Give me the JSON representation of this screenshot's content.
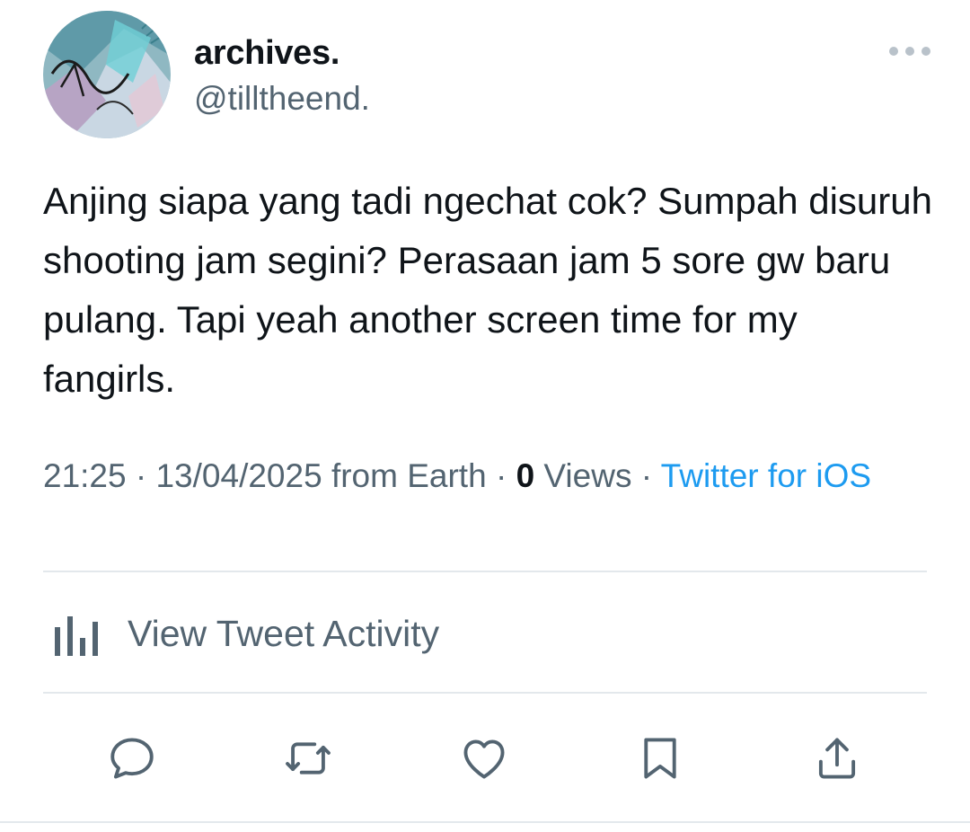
{
  "profile": {
    "name": "archives.",
    "handle": "@tilltheend."
  },
  "tweet": {
    "text": "Anjing siapa yang tadi ngechat cok? Sumpah disuruh shooting jam segini? Perasaan jam 5 sore gw baru pulang. Tapi yeah another screen time for my fangirls."
  },
  "meta": {
    "time": "21:25",
    "date": "13/04/2025",
    "location": "from Earth",
    "separator": " · ",
    "views_count": "0",
    "views_label": "Views",
    "source": "Twitter for iOS"
  },
  "activity": {
    "label": "View Tweet Activity",
    "icon": "bar-chart-icon"
  },
  "actions": {
    "icons": [
      "reply-icon",
      "retweet-icon",
      "like-icon",
      "bookmark-icon",
      "share-icon"
    ]
  },
  "colors": {
    "text": "#0f1419",
    "secondary": "#536471",
    "link": "#1d9bf0",
    "divider": "#e3e8ec"
  }
}
